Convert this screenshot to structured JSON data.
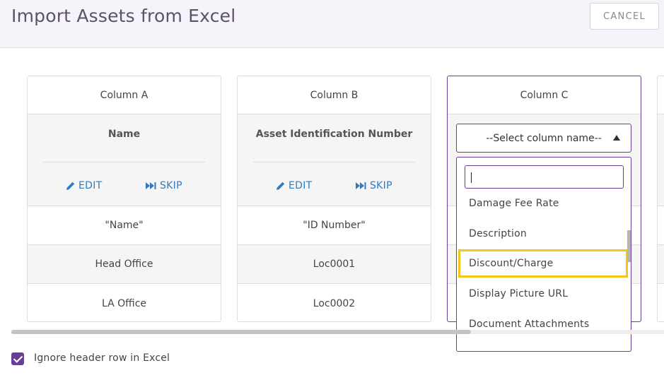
{
  "header": {
    "title": "Import Assets from Excel",
    "cancel_label": "CANCEL"
  },
  "columns": [
    {
      "heading": "Column A",
      "mapped_name": "Name",
      "edit_label": "EDIT",
      "skip_label": "SKIP",
      "rows": [
        "\"Name\"",
        "Head Office",
        "LA Office"
      ]
    },
    {
      "heading": "Column B",
      "mapped_name": "Asset Identification Number",
      "edit_label": "EDIT",
      "skip_label": "SKIP",
      "rows": [
        "\"ID Number\"",
        "Loc0001",
        "Loc0002"
      ]
    },
    {
      "heading": "Column C",
      "select": {
        "value": "--Select column name--",
        "search_value": "",
        "options": [
          "Damage Fee Rate",
          "Description",
          "Discount/Charge",
          "Display Picture URL",
          "Document Attachments"
        ],
        "highlighted": "Discount/Charge"
      }
    }
  ],
  "footer": {
    "ignore_header_label": "Ignore header row in Excel",
    "ignore_header_checked": true
  },
  "colors": {
    "accent": "#6a3d99",
    "link": "#2f7ac0",
    "highlight": "#f5c518"
  }
}
